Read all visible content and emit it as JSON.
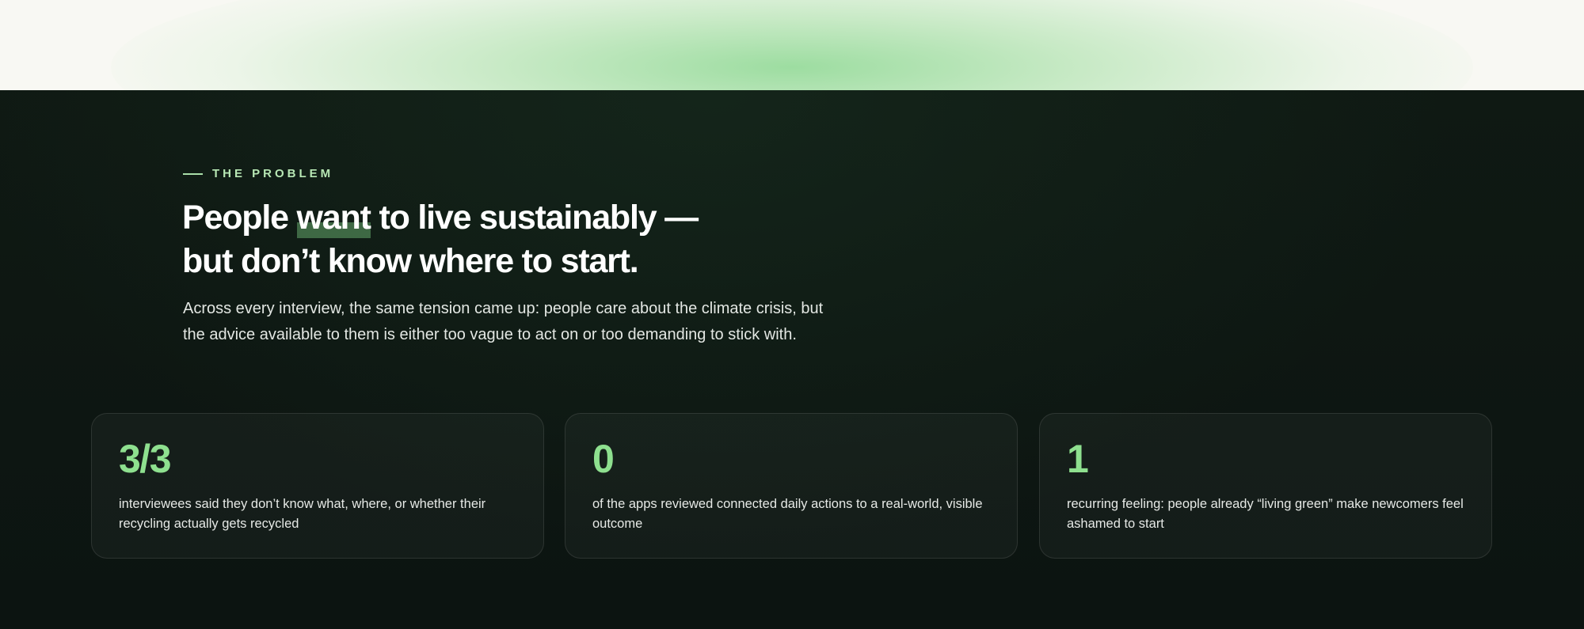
{
  "problem": {
    "eyebrow": "THE PROBLEM",
    "headline_part1": "People ",
    "headline_highlight": "want",
    "headline_part2": " to live sustainably —",
    "headline_line2": "but don’t know where to start.",
    "intro": "Across every interview, the same tension came up: people care about the climate crisis, but the advice available to them is either too vague to act on or too demanding to stick with."
  },
  "stats": [
    {
      "value": "3/3",
      "description": "interviewees said they don’t know what, where, or whether their recycling actually gets recycled"
    },
    {
      "value": "0",
      "description": "of the apps reviewed connected daily actions to a real-world, visible outcome"
    },
    {
      "value": "1",
      "description": "recurring feeling: people already “living green” make newcomers feel ashamed to start"
    }
  ],
  "colors": {
    "accent": "#8ee08f",
    "background": "#0d1612",
    "top_band": "#f8f8f3"
  }
}
